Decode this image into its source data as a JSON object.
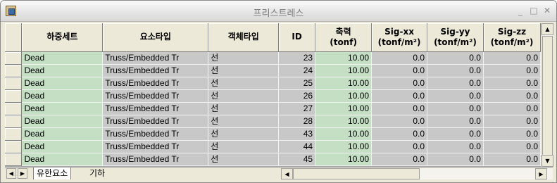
{
  "window": {
    "title": "프리스트레스",
    "minimize_label": "_",
    "maximize_label": "□",
    "close_label": "✕"
  },
  "table": {
    "columns": [
      "하중세트",
      "요소타입",
      "객체타입",
      "ID",
      "축력\n(tonf)",
      "Sig-xx\n(tonf/m²)",
      "Sig-yy\n(tonf/m²)",
      "Sig-zz\n(tonf/m²)"
    ],
    "rows": [
      [
        "Dead",
        "Truss/Embedded Tr",
        "선",
        "23",
        "10.00",
        "0.0",
        "0.0",
        "0.0"
      ],
      [
        "Dead",
        "Truss/Embedded Tr",
        "선",
        "24",
        "10.00",
        "0.0",
        "0.0",
        "0.0"
      ],
      [
        "Dead",
        "Truss/Embedded Tr",
        "선",
        "25",
        "10.00",
        "0.0",
        "0.0",
        "0.0"
      ],
      [
        "Dead",
        "Truss/Embedded Tr",
        "선",
        "26",
        "10.00",
        "0.0",
        "0.0",
        "0.0"
      ],
      [
        "Dead",
        "Truss/Embedded Tr",
        "선",
        "27",
        "10.00",
        "0.0",
        "0.0",
        "0.0"
      ],
      [
        "Dead",
        "Truss/Embedded Tr",
        "선",
        "28",
        "10.00",
        "0.0",
        "0.0",
        "0.0"
      ],
      [
        "Dead",
        "Truss/Embedded Tr",
        "선",
        "43",
        "10.00",
        "0.0",
        "0.0",
        "0.0"
      ],
      [
        "Dead",
        "Truss/Embedded Tr",
        "선",
        "44",
        "10.00",
        "0.0",
        "0.0",
        "0.0"
      ],
      [
        "Dead",
        "Truss/Embedded Tr",
        "선",
        "45",
        "10.00",
        "0.0",
        "0.0",
        "0.0"
      ]
    ]
  },
  "tabs": [
    "유한요소",
    "기하"
  ],
  "scroll": {
    "up": "▲",
    "down": "▼",
    "left": "◀",
    "right": "▶",
    "tab_first": "|◀",
    "tab_last": "▶|"
  },
  "colors": {
    "editable_cell": "#c4dfc4",
    "readonly_cell": "#c8c8c8",
    "header": "#ece9d8"
  }
}
